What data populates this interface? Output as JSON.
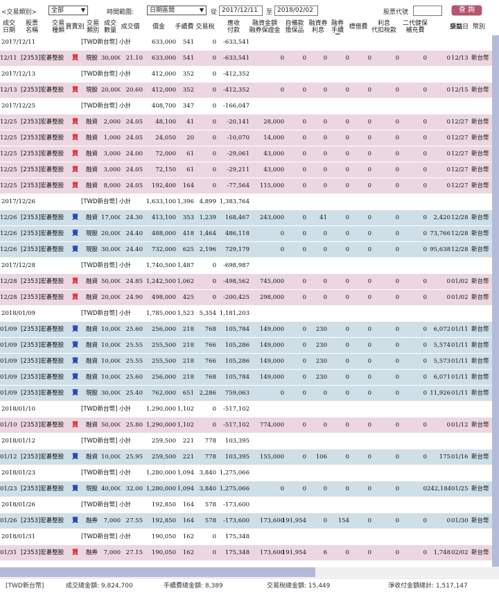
{
  "filter": {
    "trade_type_label": "<交易類別>",
    "trade_type_value": "全部",
    "period_label": "時間範圍:",
    "period_value": "日期區間",
    "from_label": "從",
    "from_date": "2017/12/11",
    "to_label": "至",
    "to_date": "2018/02/02",
    "stock_code_label": "股票代號",
    "stock_code_value": "",
    "query_button": "查 詢"
  },
  "columns": {
    "date": "成交\n日期",
    "stock": "股票\n名稱",
    "trade_kind": "交易\n種類",
    "buy_sell": "買賣別",
    "trade_class": "交易\n類別",
    "qty": "成交\n數量",
    "price": "成交價",
    "amount": "價金",
    "fee": "手續費",
    "tax": "交易稅",
    "payable": "應收\n付款",
    "margin_amount": "融資金額\n融券保證金",
    "self_deposit": "自備款\n擔保品",
    "margin_interest": "融資券\n利息",
    "short_fee": "融券\n手續費",
    "borrow_fee": "標借費",
    "interest_tax": "利息\n代扣稅款",
    "health_ins": "二代健保\n補充費",
    "pnl": "損益",
    "settle_date": "交割日",
    "currency": "幣別"
  },
  "rows": [
    {
      "type": "sub",
      "date": "2017/12/11",
      "label": "[TWD新台幣] 小計",
      "amount": "633,000",
      "fee": "541",
      "tax": "0",
      "payable": "-633,541"
    },
    {
      "type": "buy",
      "date": "12/11",
      "stock": "[2353]宏碁整股",
      "bs": "買",
      "cls": "現股",
      "qty": "30,000",
      "price": "21.10",
      "amount": "633,000",
      "fee": "541",
      "tax": "0",
      "payable": "-633,541",
      "margin": "0",
      "self": "0",
      "mi": "0",
      "sf": "0",
      "bf": "0",
      "it": "0",
      "hi": "0",
      "pnl": "0",
      "settle": "12/13",
      "cur": "新台幣"
    },
    {
      "type": "sub",
      "date": "2017/12/13",
      "label": "[TWD新台幣] 小計",
      "amount": "412,000",
      "fee": "352",
      "tax": "0",
      "payable": "-412,352"
    },
    {
      "type": "buy",
      "date": "12/13",
      "stock": "[2353]宏碁整股",
      "bs": "買",
      "cls": "現股",
      "qty": "20,000",
      "price": "20.60",
      "amount": "412,000",
      "fee": "352",
      "tax": "0",
      "payable": "-412,352",
      "margin": "0",
      "self": "0",
      "mi": "0",
      "sf": "0",
      "bf": "0",
      "it": "0",
      "hi": "0",
      "pnl": "0",
      "settle": "12/15",
      "cur": "新台幣"
    },
    {
      "type": "sub",
      "date": "2017/12/25",
      "label": "[TWD新台幣] 小計",
      "amount": "408,700",
      "fee": "347",
      "tax": "0",
      "payable": "-166,047"
    },
    {
      "type": "buy",
      "date": "12/25",
      "stock": "[2353]宏碁整股",
      "bs": "買",
      "cls": "融資",
      "qty": "2,000",
      "price": "24.05",
      "amount": "48,100",
      "fee": "41",
      "tax": "0",
      "payable": "-20,141",
      "margin": "28,000",
      "self": "0",
      "mi": "0",
      "sf": "0",
      "bf": "0",
      "it": "0",
      "hi": "0",
      "pnl": "0",
      "settle": "12/27",
      "cur": "新台幣"
    },
    {
      "type": "buy",
      "date": "12/25",
      "stock": "[2353]宏碁整股",
      "bs": "買",
      "cls": "融資",
      "qty": "1,000",
      "price": "24.05",
      "amount": "24,050",
      "fee": "20",
      "tax": "0",
      "payable": "-10,070",
      "margin": "14,000",
      "self": "0",
      "mi": "0",
      "sf": "0",
      "bf": "0",
      "it": "0",
      "hi": "0",
      "pnl": "0",
      "settle": "12/27",
      "cur": "新台幣"
    },
    {
      "type": "buy",
      "date": "12/25",
      "stock": "[2353]宏碁整股",
      "bs": "買",
      "cls": "融資",
      "qty": "3,000",
      "price": "24.00",
      "amount": "72,000",
      "fee": "61",
      "tax": "0",
      "payable": "-29,061",
      "margin": "43,000",
      "self": "0",
      "mi": "0",
      "sf": "0",
      "bf": "0",
      "it": "0",
      "hi": "0",
      "pnl": "0",
      "settle": "12/27",
      "cur": "新台幣"
    },
    {
      "type": "buy",
      "date": "12/25",
      "stock": "[2353]宏碁整股",
      "bs": "買",
      "cls": "融資",
      "qty": "3,000",
      "price": "24.05",
      "amount": "72,150",
      "fee": "61",
      "tax": "0",
      "payable": "-29,211",
      "margin": "43,000",
      "self": "0",
      "mi": "0",
      "sf": "0",
      "bf": "0",
      "it": "0",
      "hi": "0",
      "pnl": "0",
      "settle": "12/27",
      "cur": "新台幣"
    },
    {
      "type": "buy",
      "date": "12/25",
      "stock": "[2353]宏碁整股",
      "bs": "買",
      "cls": "融資",
      "qty": "8,000",
      "price": "24.05",
      "amount": "192,400",
      "fee": "164",
      "tax": "0",
      "payable": "-77,564",
      "margin": "115,000",
      "self": "0",
      "mi": "0",
      "sf": "0",
      "bf": "0",
      "it": "0",
      "hi": "0",
      "pnl": "0",
      "settle": "12/27",
      "cur": "新台幣"
    },
    {
      "type": "sub",
      "date": "2017/12/26",
      "label": "[TWD新台幣] 小計",
      "amount": "1,633,100",
      "fee": "1,396",
      "tax": "4,899",
      "payable": "1,383,764"
    },
    {
      "type": "sell",
      "date": "12/26",
      "stock": "[2353]宏碁整股",
      "bs": "賣",
      "cls": "融資",
      "qty": "17,000",
      "price": "24.30",
      "amount": "413,100",
      "fee": "353",
      "tax": "1,239",
      "payable": "168,467",
      "margin": "243,000",
      "self": "0",
      "mi": "41",
      "sf": "0",
      "bf": "0",
      "it": "0",
      "hi": "0",
      "pnl": "2,420",
      "settle": "12/28",
      "cur": "新台幣"
    },
    {
      "type": "sell",
      "date": "12/26",
      "stock": "[2353]宏碁整股",
      "bs": "賣",
      "cls": "現股",
      "qty": "20,000",
      "price": "24.40",
      "amount": "488,000",
      "fee": "418",
      "tax": "1,464",
      "payable": "486,118",
      "margin": "0",
      "self": "0",
      "mi": "0",
      "sf": "0",
      "bf": "0",
      "it": "0",
      "hi": "0",
      "pnl": "73,766",
      "settle": "12/28",
      "cur": "新台幣"
    },
    {
      "type": "sell",
      "date": "12/26",
      "stock": "[2353]宏碁整股",
      "bs": "賣",
      "cls": "現股",
      "qty": "30,000",
      "price": "24.40",
      "amount": "732,000",
      "fee": "625",
      "tax": "2,196",
      "payable": "729,179",
      "margin": "0",
      "self": "0",
      "mi": "0",
      "sf": "0",
      "bf": "0",
      "it": "0",
      "hi": "0",
      "pnl": "95,638",
      "settle": "12/28",
      "cur": "新台幣"
    },
    {
      "type": "sub",
      "date": "2017/12/28",
      "label": "[TWD新台幣] 小計",
      "amount": "1,740,500",
      "fee": "1,487",
      "tax": "0",
      "payable": "-698,987"
    },
    {
      "type": "buy",
      "date": "12/28",
      "stock": "[2353]宏碁整股",
      "bs": "買",
      "cls": "融資",
      "qty": "50,000",
      "price": "24.85",
      "amount": "1,242,500",
      "fee": "1,062",
      "tax": "0",
      "payable": "-498,562",
      "margin": "745,000",
      "self": "0",
      "mi": "0",
      "sf": "0",
      "bf": "0",
      "it": "0",
      "hi": "0",
      "pnl": "0",
      "settle": "01/02",
      "cur": "新台幣"
    },
    {
      "type": "buy",
      "date": "12/28",
      "stock": "[2353]宏碁整股",
      "bs": "買",
      "cls": "融資",
      "qty": "20,000",
      "price": "24.90",
      "amount": "498,000",
      "fee": "425",
      "tax": "0",
      "payable": "-200,425",
      "margin": "298,000",
      "self": "0",
      "mi": "0",
      "sf": "0",
      "bf": "0",
      "it": "0",
      "hi": "0",
      "pnl": "0",
      "settle": "01/02",
      "cur": "新台幣"
    },
    {
      "type": "sub",
      "date": "2018/01/09",
      "label": "[TWD新台幣] 小計",
      "amount": "1,785,000",
      "fee": "1,523",
      "tax": "5,354",
      "payable": "1,181,203"
    },
    {
      "type": "sell",
      "date": "01/09",
      "stock": "[2353]宏碁整股",
      "bs": "賣",
      "cls": "融資",
      "qty": "10,000",
      "price": "25.60",
      "amount": "256,000",
      "fee": "218",
      "tax": "768",
      "payable": "105,784",
      "margin": "149,000",
      "self": "0",
      "mi": "230",
      "sf": "0",
      "bf": "0",
      "it": "0",
      "hi": "0",
      "pnl": "6,072",
      "settle": "01/11",
      "cur": "新台幣"
    },
    {
      "type": "sell",
      "date": "01/09",
      "stock": "[2353]宏碁整股",
      "bs": "賣",
      "cls": "融資",
      "qty": "10,000",
      "price": "25.55",
      "amount": "255,500",
      "fee": "218",
      "tax": "766",
      "payable": "105,286",
      "margin": "149,000",
      "self": "0",
      "mi": "230",
      "sf": "0",
      "bf": "0",
      "it": "0",
      "hi": "0",
      "pnl": "5,574",
      "settle": "01/11",
      "cur": "新台幣"
    },
    {
      "type": "sell",
      "date": "01/09",
      "stock": "[2353]宏碁整股",
      "bs": "賣",
      "cls": "融資",
      "qty": "10,000",
      "price": "25.55",
      "amount": "255,500",
      "fee": "218",
      "tax": "766",
      "payable": "105,286",
      "margin": "149,000",
      "self": "0",
      "mi": "230",
      "sf": "0",
      "bf": "0",
      "it": "0",
      "hi": "0",
      "pnl": "5,573",
      "settle": "01/11",
      "cur": "新台幣"
    },
    {
      "type": "sell",
      "date": "01/09",
      "stock": "[2353]宏碁整股",
      "bs": "賣",
      "cls": "融資",
      "qty": "10,000",
      "price": "25.60",
      "amount": "256,000",
      "fee": "218",
      "tax": "768",
      "payable": "105,784",
      "margin": "149,000",
      "self": "0",
      "mi": "230",
      "sf": "0",
      "bf": "0",
      "it": "0",
      "hi": "0",
      "pnl": "6,071",
      "settle": "01/11",
      "cur": "新台幣"
    },
    {
      "type": "sell",
      "date": "01/09",
      "stock": "[2353]宏碁整股",
      "bs": "賣",
      "cls": "現股",
      "qty": "30,000",
      "price": "25.40",
      "amount": "762,000",
      "fee": "651",
      "tax": "2,286",
      "payable": "759,063",
      "margin": "0",
      "self": "0",
      "mi": "0",
      "sf": "0",
      "bf": "0",
      "it": "0",
      "hi": "0",
      "pnl": "11,926",
      "settle": "01/11",
      "cur": "新台幣"
    },
    {
      "type": "sub",
      "date": "2018/01/10",
      "label": "[TWD新台幣] 小計",
      "amount": "1,290,000",
      "fee": "1,102",
      "tax": "0",
      "payable": "-517,102"
    },
    {
      "type": "buy",
      "date": "01/10",
      "stock": "[2353]宏碁整股",
      "bs": "買",
      "cls": "融資",
      "qty": "50,000",
      "price": "25.80",
      "amount": "1,290,000",
      "fee": "1,102",
      "tax": "0",
      "payable": "-517,102",
      "margin": "774,000",
      "self": "0",
      "mi": "0",
      "sf": "0",
      "bf": "0",
      "it": "0",
      "hi": "0",
      "pnl": "0",
      "settle": "01/12",
      "cur": "新台幣"
    },
    {
      "type": "sub",
      "date": "2018/01/12",
      "label": "[TWD新台幣] 小計",
      "amount": "259,500",
      "fee": "221",
      "tax": "778",
      "payable": "103,395"
    },
    {
      "type": "sell",
      "date": "01/12",
      "stock": "[2353]宏碁整股",
      "bs": "賣",
      "cls": "融資",
      "qty": "10,000",
      "price": "25.95",
      "amount": "259,500",
      "fee": "221",
      "tax": "778",
      "payable": "103,395",
      "margin": "155,000",
      "self": "0",
      "mi": "106",
      "sf": "0",
      "bf": "0",
      "it": "0",
      "hi": "0",
      "pnl": "175",
      "settle": "01/16",
      "cur": "新台幣"
    },
    {
      "type": "sub",
      "date": "2018/01/23",
      "label": "[TWD新台幣] 小計",
      "amount": "1,280,000",
      "fee": "1,094",
      "tax": "3,840",
      "payable": "1,275,066"
    },
    {
      "type": "sell",
      "date": "01/23",
      "stock": "[2353]宏碁整股",
      "bs": "賣",
      "cls": "現股",
      "qty": "40,000",
      "price": "32.00",
      "amount": "1,280,000",
      "fee": "1,094",
      "tax": "3,840",
      "payable": "1,275,066",
      "margin": "0",
      "self": "0",
      "mi": "0",
      "sf": "0",
      "bf": "0",
      "it": "0",
      "hi": "0",
      "pnl": "242,184",
      "settle": "01/25",
      "cur": "新台幣"
    },
    {
      "type": "sub",
      "date": "2018/01/26",
      "label": "[TWD新台幣] 小計",
      "amount": "192,850",
      "fee": "164",
      "tax": "578",
      "payable": "-173,600"
    },
    {
      "type": "sell",
      "date": "01/26",
      "stock": "[2353]宏碁整股",
      "bs": "賣",
      "cls": "融券",
      "qty": "7,000",
      "price": "27.55",
      "amount": "192,850",
      "fee": "164",
      "tax": "578",
      "payable": "-173,600",
      "margin": "173,600",
      "self": "191,954",
      "mi": "0",
      "sf": "154",
      "bf": "0",
      "it": "0",
      "hi": "0",
      "pnl": "0",
      "settle": "01/30",
      "cur": "新台幣"
    },
    {
      "type": "sub",
      "date": "2018/01/31",
      "label": "[TWD新台幣] 小計",
      "amount": "190,050",
      "fee": "162",
      "tax": "0",
      "payable": "175,348"
    },
    {
      "type": "buy",
      "date": "01/31",
      "stock": "[2353]宏碁整股",
      "bs": "買",
      "cls": "融券",
      "qty": "7,000",
      "price": "27.15",
      "amount": "190,050",
      "fee": "162",
      "tax": "0",
      "payable": "175,348",
      "margin": "173,600",
      "self": "191,954",
      "mi": "6",
      "sf": "0",
      "bf": "0",
      "it": "0",
      "hi": "0",
      "pnl": "1,748",
      "settle": "02/02",
      "cur": "新台幣"
    }
  ],
  "footer": {
    "currency": "[TWD新台幣]",
    "total_amount_label": "成交總金額: 9,824,700",
    "total_fee_label": "手續費總金額: 8,389",
    "total_tax_label": "交易稅總金額: 15,449",
    "net_label": "淨收付金額總計: 1,517,147"
  }
}
